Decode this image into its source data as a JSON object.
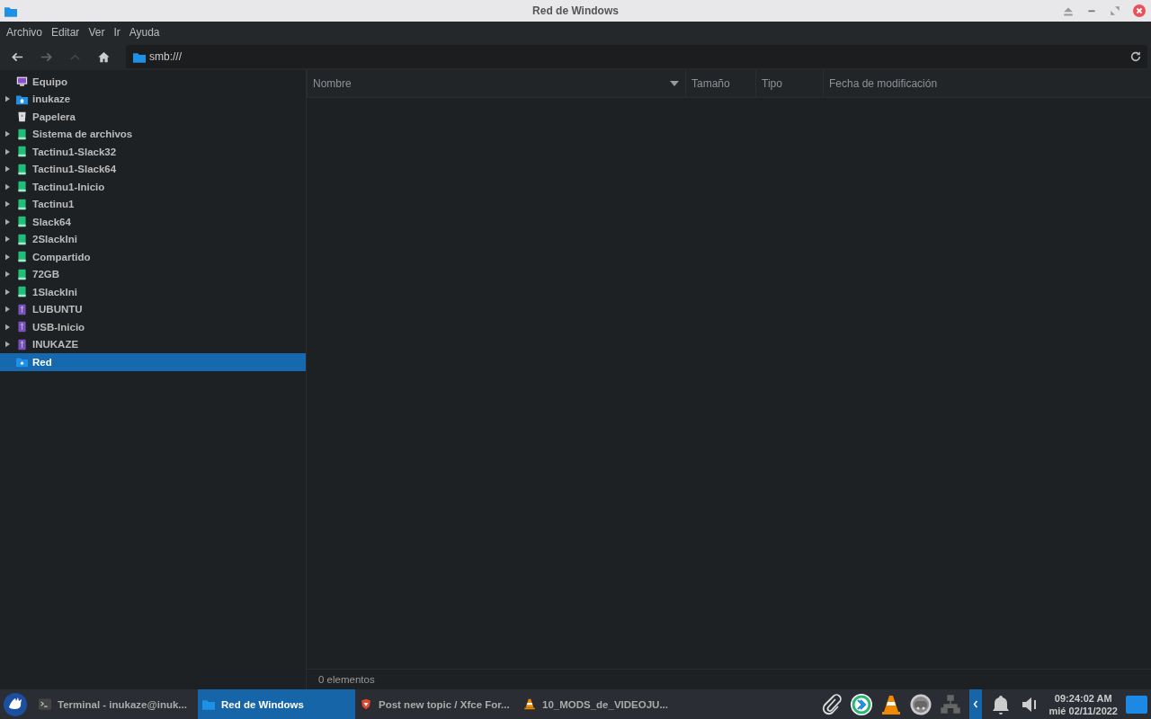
{
  "window": {
    "title": "Red de Windows"
  },
  "menu": [
    "Archivo",
    "Editar",
    "Ver",
    "Ir",
    "Ayuda"
  ],
  "location": {
    "value": "smb:///"
  },
  "sidebar": {
    "items": [
      {
        "label": "Equipo",
        "kind": "computer",
        "expandable": false,
        "selected": false
      },
      {
        "label": "inukaze",
        "kind": "home",
        "expandable": true,
        "selected": false
      },
      {
        "label": "Papelera",
        "kind": "trash",
        "expandable": false,
        "selected": false
      },
      {
        "label": "Sistema de archivos",
        "kind": "drive",
        "expandable": true,
        "selected": false
      },
      {
        "label": "Tactinu1-Slack32",
        "kind": "drive",
        "expandable": true,
        "selected": false
      },
      {
        "label": "Tactinu1-Slack64",
        "kind": "drive",
        "expandable": true,
        "selected": false
      },
      {
        "label": "Tactinu1-Inicio",
        "kind": "drive",
        "expandable": true,
        "selected": false
      },
      {
        "label": "Tactinu1",
        "kind": "drive",
        "expandable": true,
        "selected": false
      },
      {
        "label": "Slack64",
        "kind": "drive",
        "expandable": true,
        "selected": false
      },
      {
        "label": "2SlackIni",
        "kind": "drive",
        "expandable": true,
        "selected": false
      },
      {
        "label": "Compartido",
        "kind": "drive",
        "expandable": true,
        "selected": false
      },
      {
        "label": "72GB",
        "kind": "drive",
        "expandable": true,
        "selected": false
      },
      {
        "label": "1SlackIni",
        "kind": "drive",
        "expandable": true,
        "selected": false
      },
      {
        "label": "LUBUNTU",
        "kind": "usb",
        "expandable": true,
        "selected": false
      },
      {
        "label": "USB-Inicio",
        "kind": "usb",
        "expandable": true,
        "selected": false
      },
      {
        "label": "INUKAZE",
        "kind": "usb",
        "expandable": true,
        "selected": false
      },
      {
        "label": "Red",
        "kind": "network",
        "expandable": false,
        "selected": true
      }
    ]
  },
  "table": {
    "columns": [
      {
        "label": "Nombre",
        "sorted": true
      },
      {
        "label": "Tamaño",
        "sorted": false
      },
      {
        "label": "Tipo",
        "sorted": false
      },
      {
        "label": "Fecha de modificación",
        "sorted": false
      }
    ]
  },
  "status_bar": "0 elementos",
  "taskbar": {
    "tasks": [
      {
        "label": "Terminal - inukaze@inuk...",
        "kind": "terminal",
        "selected": false
      },
      {
        "label": "Red de Windows",
        "kind": "folder",
        "selected": true
      },
      {
        "label": "Post new topic / Xfce For...",
        "kind": "browser",
        "selected": false
      },
      {
        "label": "10_MODS_de_VIDEOJU...",
        "kind": "cone",
        "selected": false
      }
    ],
    "clock": {
      "time": "09:24:02 AM",
      "date": "mié 02/11/2022"
    }
  }
}
